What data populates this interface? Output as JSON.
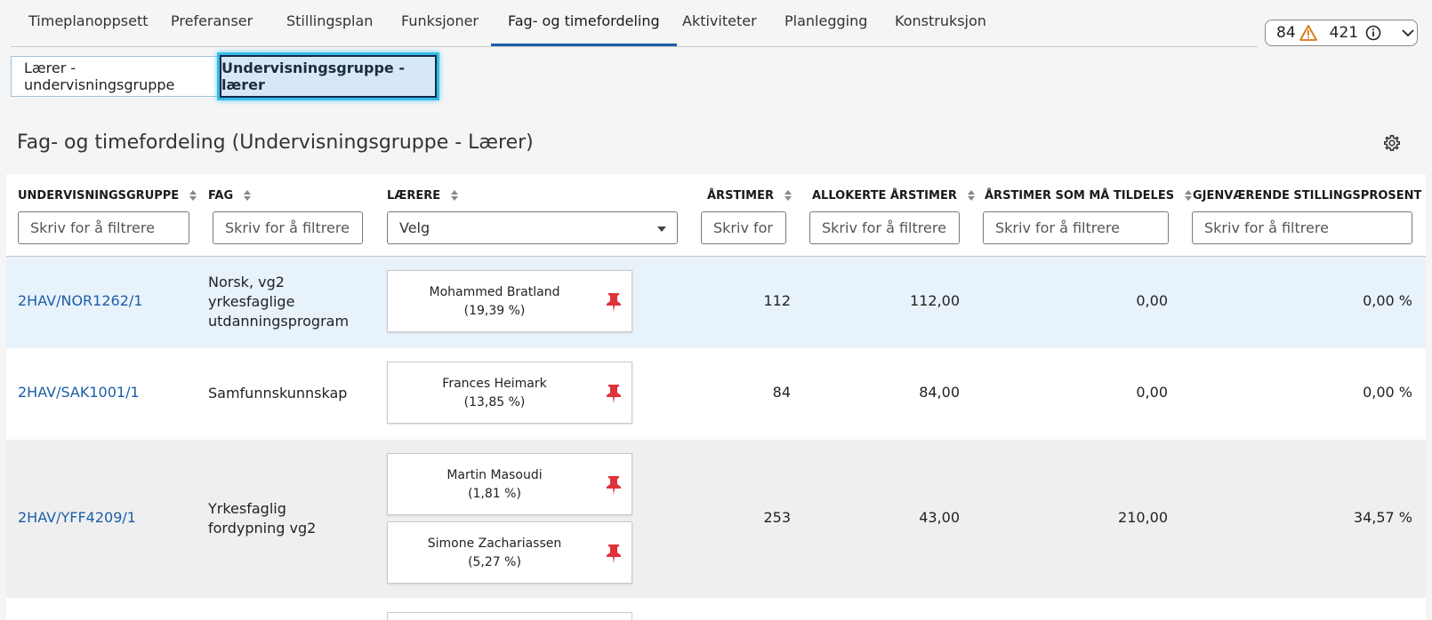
{
  "nav": {
    "tabs": [
      {
        "label": "Timeplanoppsett"
      },
      {
        "label": "Preferanser"
      },
      {
        "label": "Stillingsplan"
      },
      {
        "label": "Funksjoner"
      },
      {
        "label": "Fag- og timefordeling"
      },
      {
        "label": "Aktiviteter"
      },
      {
        "label": "Planlegging"
      },
      {
        "label": "Konstruksjon"
      }
    ],
    "active_tab": "Fag- og timefordeling"
  },
  "status": {
    "warnings_count": "84",
    "info_count": "421"
  },
  "toggle": {
    "option_a": "Lærer - undervisningsgruppe",
    "option_b": "Undervisningsgruppe - lærer",
    "selected": "Undervisningsgruppe - lærer"
  },
  "page": {
    "title": "Fag- og timefordeling (Undervisningsgruppe - Lærer)"
  },
  "table": {
    "columns": [
      {
        "label": "UNDERVISNINGSGRUPPE",
        "placeholder": "Skriv for å filtrere"
      },
      {
        "label": "FAG",
        "placeholder": "Skriv for å filtrere"
      },
      {
        "label": "LÆRERE",
        "placeholder": "Velg"
      },
      {
        "label": "ÅRSTIMER",
        "placeholder": "Skriv for"
      },
      {
        "label": "ALLOKERTE ÅRSTIMER",
        "placeholder": "Skriv for å filtrere"
      },
      {
        "label": "ÅRSTIMER SOM MÅ TILDELES",
        "placeholder": "Skriv for å filtrere"
      },
      {
        "label": "GJENVÆRENDE STILLINGSPROSENT",
        "placeholder": "Skriv for å filtrere"
      }
    ],
    "rows": [
      {
        "group": "2HAV/NOR1262/1",
        "subject": "Norsk, vg2 yrkesfaglige utdanningsprogram",
        "teachers": [
          {
            "name": "Mohammed Bratland",
            "percent": "(19,39 %)"
          }
        ],
        "annual_hours": "112",
        "allocated": "112,00",
        "to_assign": "0,00",
        "remaining_pct": "0,00 %"
      },
      {
        "group": "2HAV/SAK1001/1",
        "subject": "Samfunnskunnskap",
        "teachers": [
          {
            "name": "Frances Heimark",
            "percent": "(13,85 %)"
          }
        ],
        "annual_hours": "84",
        "allocated": "84,00",
        "to_assign": "0,00",
        "remaining_pct": "0,00 %"
      },
      {
        "group": "2HAV/YFF4209/1",
        "subject": "Yrkesfaglig fordypning vg2",
        "teachers": [
          {
            "name": "Martin Masoudi",
            "percent": "(1,81 %)"
          },
          {
            "name": "Simone Zachariassen",
            "percent": "(5,27 %)"
          }
        ],
        "annual_hours": "253",
        "allocated": "43,00",
        "to_assign": "210,00",
        "remaining_pct": "34,57 %"
      }
    ]
  },
  "colors": {
    "link": "#1b5ea8",
    "pin": "#e0323a",
    "active_tab_underline": "#1b5ea8",
    "selected_row": "#e8f2fb"
  },
  "icons": [
    "warning-icon",
    "info-icon",
    "chevron-down-icon",
    "gear-icon",
    "sort-icon",
    "pin-icon",
    "dropdown-caret-icon"
  ]
}
